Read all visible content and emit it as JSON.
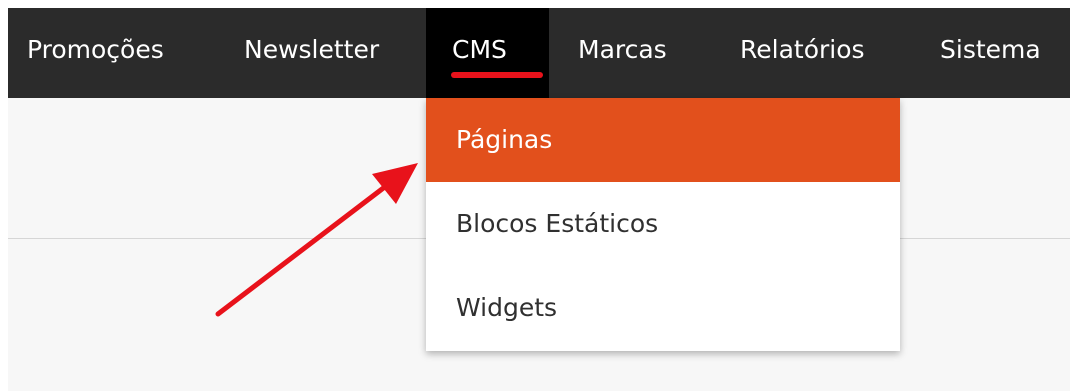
{
  "nav": {
    "items": [
      {
        "label": "Promoções"
      },
      {
        "label": "Newsletter"
      },
      {
        "label": "CMS",
        "active": true
      },
      {
        "label": "Marcas"
      },
      {
        "label": "Relatórios"
      },
      {
        "label": "Sistema"
      }
    ]
  },
  "dropdown": {
    "items": [
      {
        "label": "Páginas",
        "highlighted": true
      },
      {
        "label": "Blocos Estáticos"
      },
      {
        "label": "Widgets"
      }
    ]
  },
  "colors": {
    "nav_background": "#2b2b2b",
    "nav_active_background": "#000000",
    "active_underline": "#e8121b",
    "highlight": "#e2501c",
    "annotation_arrow": "#e8121b"
  },
  "annotation": {
    "icon": "red-arrow-icon",
    "points_to": "Páginas"
  }
}
